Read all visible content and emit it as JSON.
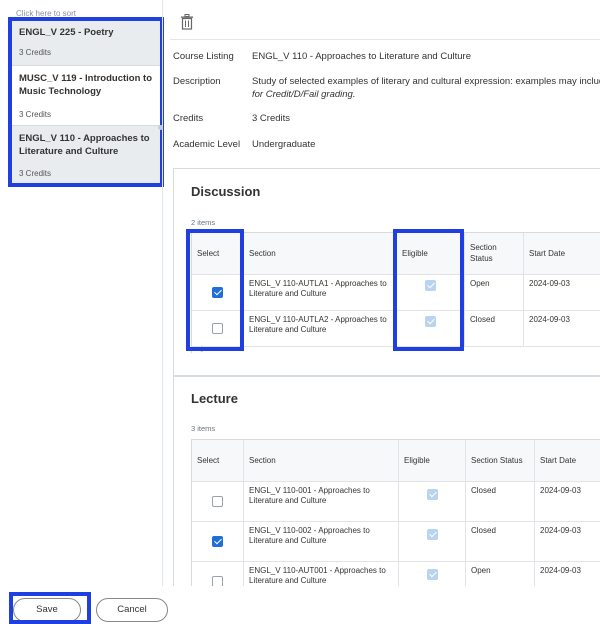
{
  "sort_hint": "Click here to sort",
  "courses": [
    {
      "title": "ENGL_V 225 - Poetry",
      "credits": "3 Credits"
    },
    {
      "title": "MUSC_V 119 - Introduction to Music Technology",
      "credits": "3 Credits"
    },
    {
      "title": "ENGL_V 110 - Approaches to Literature and Culture",
      "credits": "3 Credits"
    }
  ],
  "details": {
    "course_listing_label": "Course Listing",
    "course_listing_value": "ENGL_V 110 - Approaches to Literature and Culture",
    "description_label": "Description",
    "description_value": "Study of selected examples of literary and cultural expression: examples may includ",
    "description_note": "for Credit/D/Fail grading.",
    "credits_label": "Credits",
    "credits_value": "3 Credits",
    "level_label": "Academic Level",
    "level_value": "Undergraduate"
  },
  "discussion": {
    "title": "Discussion",
    "count": "2 items",
    "headers": {
      "select": "Select",
      "section": "Section",
      "eligible": "Eligible",
      "status": "Section Status",
      "start": "Start Date"
    },
    "rows": [
      {
        "selected": true,
        "section": "ENGL_V 110-AUTLA1 - Approaches to Literature and Culture",
        "status": "Open",
        "start": "2024-09-03"
      },
      {
        "selected": false,
        "section": "ENGL_V 110-AUTLA2 - Approaches to Literature and Culture",
        "status": "Closed",
        "start": "2024-09-03"
      }
    ]
  },
  "lecture": {
    "title": "Lecture",
    "count": "3 items",
    "headers": {
      "select": "Select",
      "section": "Section",
      "eligible": "Eligible",
      "status": "Section Status",
      "start": "Start Date"
    },
    "rows": [
      {
        "selected": false,
        "section": "ENGL_V 110-001 - Approaches to Literature and Culture",
        "status": "Closed",
        "start": "2024-09-03"
      },
      {
        "selected": true,
        "section": "ENGL_V 110-002 - Approaches to Literature and Culture",
        "status": "Closed",
        "start": "2024-09-03"
      },
      {
        "selected": false,
        "section": "ENGL_V 110-AUT001 - Approaches to Literature and Culture",
        "status": "Open",
        "start": "2024-09-03"
      }
    ]
  },
  "footer": {
    "save_label": "Save",
    "cancel_label": "Cancel"
  },
  "colors": {
    "highlight": "#1f3fe0",
    "checkbox_on": "#1f6fd6",
    "checkbox_disabled": "#b9d4f0"
  },
  "icons": {
    "delete": "trash-icon",
    "scroll_left": "chevron-left-icon"
  }
}
